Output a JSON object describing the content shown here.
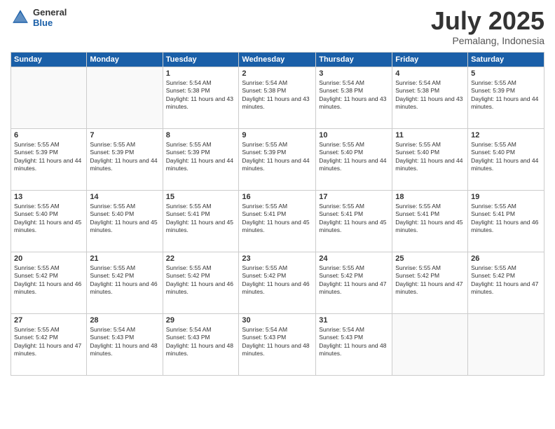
{
  "header": {
    "logo_general": "General",
    "logo_blue": "Blue",
    "month_title": "July 2025",
    "location": "Pemalang, Indonesia"
  },
  "days_of_week": [
    "Sunday",
    "Monday",
    "Tuesday",
    "Wednesday",
    "Thursday",
    "Friday",
    "Saturday"
  ],
  "weeks": [
    [
      {
        "day": "",
        "info": ""
      },
      {
        "day": "",
        "info": ""
      },
      {
        "day": "1",
        "info": "Sunrise: 5:54 AM\nSunset: 5:38 PM\nDaylight: 11 hours and 43 minutes."
      },
      {
        "day": "2",
        "info": "Sunrise: 5:54 AM\nSunset: 5:38 PM\nDaylight: 11 hours and 43 minutes."
      },
      {
        "day": "3",
        "info": "Sunrise: 5:54 AM\nSunset: 5:38 PM\nDaylight: 11 hours and 43 minutes."
      },
      {
        "day": "4",
        "info": "Sunrise: 5:54 AM\nSunset: 5:38 PM\nDaylight: 11 hours and 43 minutes."
      },
      {
        "day": "5",
        "info": "Sunrise: 5:55 AM\nSunset: 5:39 PM\nDaylight: 11 hours and 44 minutes."
      }
    ],
    [
      {
        "day": "6",
        "info": "Sunrise: 5:55 AM\nSunset: 5:39 PM\nDaylight: 11 hours and 44 minutes."
      },
      {
        "day": "7",
        "info": "Sunrise: 5:55 AM\nSunset: 5:39 PM\nDaylight: 11 hours and 44 minutes."
      },
      {
        "day": "8",
        "info": "Sunrise: 5:55 AM\nSunset: 5:39 PM\nDaylight: 11 hours and 44 minutes."
      },
      {
        "day": "9",
        "info": "Sunrise: 5:55 AM\nSunset: 5:39 PM\nDaylight: 11 hours and 44 minutes."
      },
      {
        "day": "10",
        "info": "Sunrise: 5:55 AM\nSunset: 5:40 PM\nDaylight: 11 hours and 44 minutes."
      },
      {
        "day": "11",
        "info": "Sunrise: 5:55 AM\nSunset: 5:40 PM\nDaylight: 11 hours and 44 minutes."
      },
      {
        "day": "12",
        "info": "Sunrise: 5:55 AM\nSunset: 5:40 PM\nDaylight: 11 hours and 44 minutes."
      }
    ],
    [
      {
        "day": "13",
        "info": "Sunrise: 5:55 AM\nSunset: 5:40 PM\nDaylight: 11 hours and 45 minutes."
      },
      {
        "day": "14",
        "info": "Sunrise: 5:55 AM\nSunset: 5:40 PM\nDaylight: 11 hours and 45 minutes."
      },
      {
        "day": "15",
        "info": "Sunrise: 5:55 AM\nSunset: 5:41 PM\nDaylight: 11 hours and 45 minutes."
      },
      {
        "day": "16",
        "info": "Sunrise: 5:55 AM\nSunset: 5:41 PM\nDaylight: 11 hours and 45 minutes."
      },
      {
        "day": "17",
        "info": "Sunrise: 5:55 AM\nSunset: 5:41 PM\nDaylight: 11 hours and 45 minutes."
      },
      {
        "day": "18",
        "info": "Sunrise: 5:55 AM\nSunset: 5:41 PM\nDaylight: 11 hours and 45 minutes."
      },
      {
        "day": "19",
        "info": "Sunrise: 5:55 AM\nSunset: 5:41 PM\nDaylight: 11 hours and 46 minutes."
      }
    ],
    [
      {
        "day": "20",
        "info": "Sunrise: 5:55 AM\nSunset: 5:42 PM\nDaylight: 11 hours and 46 minutes."
      },
      {
        "day": "21",
        "info": "Sunrise: 5:55 AM\nSunset: 5:42 PM\nDaylight: 11 hours and 46 minutes."
      },
      {
        "day": "22",
        "info": "Sunrise: 5:55 AM\nSunset: 5:42 PM\nDaylight: 11 hours and 46 minutes."
      },
      {
        "day": "23",
        "info": "Sunrise: 5:55 AM\nSunset: 5:42 PM\nDaylight: 11 hours and 46 minutes."
      },
      {
        "day": "24",
        "info": "Sunrise: 5:55 AM\nSunset: 5:42 PM\nDaylight: 11 hours and 47 minutes."
      },
      {
        "day": "25",
        "info": "Sunrise: 5:55 AM\nSunset: 5:42 PM\nDaylight: 11 hours and 47 minutes."
      },
      {
        "day": "26",
        "info": "Sunrise: 5:55 AM\nSunset: 5:42 PM\nDaylight: 11 hours and 47 minutes."
      }
    ],
    [
      {
        "day": "27",
        "info": "Sunrise: 5:55 AM\nSunset: 5:42 PM\nDaylight: 11 hours and 47 minutes."
      },
      {
        "day": "28",
        "info": "Sunrise: 5:54 AM\nSunset: 5:43 PM\nDaylight: 11 hours and 48 minutes."
      },
      {
        "day": "29",
        "info": "Sunrise: 5:54 AM\nSunset: 5:43 PM\nDaylight: 11 hours and 48 minutes."
      },
      {
        "day": "30",
        "info": "Sunrise: 5:54 AM\nSunset: 5:43 PM\nDaylight: 11 hours and 48 minutes."
      },
      {
        "day": "31",
        "info": "Sunrise: 5:54 AM\nSunset: 5:43 PM\nDaylight: 11 hours and 48 minutes."
      },
      {
        "day": "",
        "info": ""
      },
      {
        "day": "",
        "info": ""
      }
    ]
  ]
}
